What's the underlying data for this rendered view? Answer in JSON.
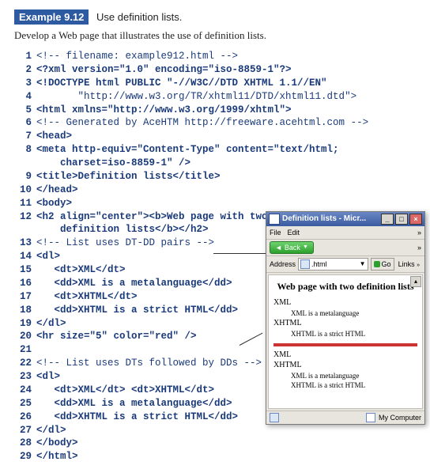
{
  "heading": {
    "label": "Example 9.12",
    "title": "Use definition lists."
  },
  "intro": "Develop a Web page that illustrates the use of definition lists.",
  "code": [
    "<!-- filename: example912.html -->",
    "<?xml version=\"1.0\" encoding=\"iso-8859-1\"?>",
    "<!DOCTYPE html PUBLIC \"-//W3C//DTD XHTML 1.1//EN\"",
    "       \"http://www.w3.org/TR/xhtml11/DTD/xhtml11.dtd\">",
    "<html xmlns=\"http://www.w3.org/1999/xhtml\">",
    "<!-- Generated by AceHTM http://freeware.acehtml.com -->",
    "<head>",
    "<meta http-equiv=\"Content-Type\" content=\"text/html;\n    charset=iso-8859-1\" />",
    "<title>Definition lists</title>",
    "</head>",
    "<body>",
    "<h2 align=\"center\"><b>Web page with two\n    definition lists</b></h2>",
    "<!-- List uses DT-DD pairs -->",
    "<dl>",
    "   <dt>XML</dt>",
    "   <dd>XML is a metalanguage</dd>",
    "   <dt>XHTML</dt>",
    "   <dd>XHTML is a strict HTML</dd>",
    "</dl>",
    "<hr size=\"5\" color=\"red\" />",
    "",
    "<!-- List uses DTs followed by DDs -->",
    "<dl>",
    "   <dt>XML</dt> <dt>XHTML</dt>",
    "   <dd>XML is a metalanguage</dd>",
    "   <dd>XHTML is a strict HTML</dd>",
    "</dl>",
    "</body>",
    "</html>"
  ],
  "bold_lines": [
    2,
    3,
    5,
    7,
    8,
    9,
    10,
    11,
    12,
    14,
    15,
    16,
    17,
    18,
    19,
    20,
    23,
    24,
    25,
    26,
    27,
    28,
    29
  ],
  "browser": {
    "title": "Definition lists - Micr...",
    "menu": {
      "file": "File",
      "edit": "Edit"
    },
    "back": "Back",
    "address_label": "Address",
    "address_value": ".html",
    "go": "Go",
    "links": "Links",
    "h2": "Web page with two definition lists",
    "list1": {
      "dt1": "XML",
      "dd1": "XML is a metalanguage",
      "dt2": "XHTML",
      "dd2": "XHTML is a strict HTML"
    },
    "list2": {
      "dt1": "XML",
      "dt2": "XHTML",
      "dd1": "XML is a metalanguage",
      "dd2": "XHTML is a strict HTML"
    },
    "status": "My Computer"
  }
}
